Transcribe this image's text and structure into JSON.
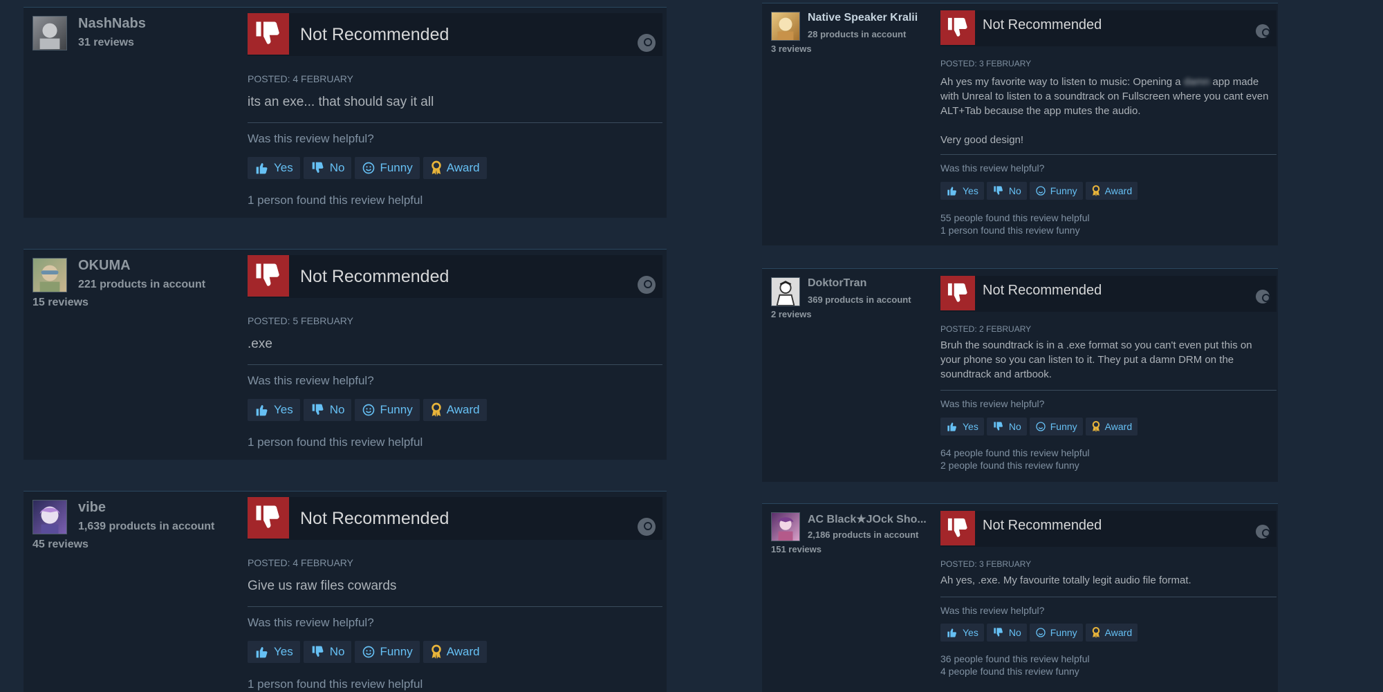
{
  "reviews": [
    {
      "persona": "NashNabs",
      "products": "",
      "reviews_count": "31 reviews",
      "verdict": "Not Recommended",
      "posted": "Posted: 4 February",
      "content": "its an exe... that should say it all",
      "helpful_question": "Was this review helpful?",
      "votes": {
        "yes": "Yes",
        "no": "No",
        "funny": "Funny",
        "award": "Award"
      },
      "helpful_count": "1 person found this review helpful",
      "funny_count": ""
    },
    {
      "persona": "OKUMA",
      "products": "221 products in account",
      "reviews_count": "15 reviews",
      "verdict": "Not Recommended",
      "posted": "Posted: 5 February",
      "content": ".exe",
      "helpful_question": "Was this review helpful?",
      "votes": {
        "yes": "Yes",
        "no": "No",
        "funny": "Funny",
        "award": "Award"
      },
      "helpful_count": "1 person found this review helpful",
      "funny_count": ""
    },
    {
      "persona": "vibe",
      "products": "1,639 products in account",
      "reviews_count": "45 reviews",
      "verdict": "Not Recommended",
      "posted": "Posted: 4 February",
      "content": "Give us raw files cowards",
      "helpful_question": "Was this review helpful?",
      "votes": {
        "yes": "Yes",
        "no": "No",
        "funny": "Funny",
        "award": "Award"
      },
      "helpful_count": "1 person found this review helpful",
      "funny_count": ""
    },
    {
      "persona": "Native Speaker Kralii",
      "products": "28 products in account",
      "reviews_count": "3 reviews",
      "verdict": "Not Recommended",
      "posted": "Posted: 3 February",
      "content_before": "Ah yes my favorite way to listen to music: Opening a ",
      "content_blur": "damn",
      "content_after": " app made with Unreal to listen to a soundtrack on Fullscreen where you cant even ALT+Tab because the app mutes the audio.\n\nVery good design!",
      "helpful_question": "Was this review helpful?",
      "votes": {
        "yes": "Yes",
        "no": "No",
        "funny": "Funny",
        "award": "Award"
      },
      "helpful_count": "55 people found this review helpful",
      "funny_count": "1 person found this review funny"
    },
    {
      "persona": "DoktorTran",
      "products": "369 products in account",
      "reviews_count": "2 reviews",
      "verdict": "Not Recommended",
      "posted": "Posted: 2 February",
      "content": "Bruh the soundtrack is in a .exe format so you can't even put this on your phone so you can listen to it. They put a damn DRM on the soundtrack and artbook.",
      "helpful_question": "Was this review helpful?",
      "votes": {
        "yes": "Yes",
        "no": "No",
        "funny": "Funny",
        "award": "Award"
      },
      "helpful_count": "64 people found this review helpful",
      "funny_count": "2 people found this review funny"
    },
    {
      "persona": "AC Black★JOck Sho...",
      "products": "2,186 products in account",
      "reviews_count": "151 reviews",
      "verdict": "Not Recommended",
      "posted": "Posted: 3 February",
      "content": "Ah yes, .exe. My favourite totally legit audio file format.",
      "helpful_question": "Was this review helpful?",
      "votes": {
        "yes": "Yes",
        "no": "No",
        "funny": "Funny",
        "award": "Award"
      },
      "helpful_count": "36 people found this review helpful",
      "funny_count": "4 people found this review funny"
    }
  ],
  "icons": {
    "thumbs_down": "thumbs-down-icon",
    "steam": "steam-icon",
    "thumbs_up": "thumbs-up-icon",
    "funny": "smile-icon",
    "award": "award-icon"
  },
  "colors": {
    "verdict_red": "#a3262a",
    "link_blue": "#66c0f4",
    "award_gold": "#e8b43a"
  }
}
